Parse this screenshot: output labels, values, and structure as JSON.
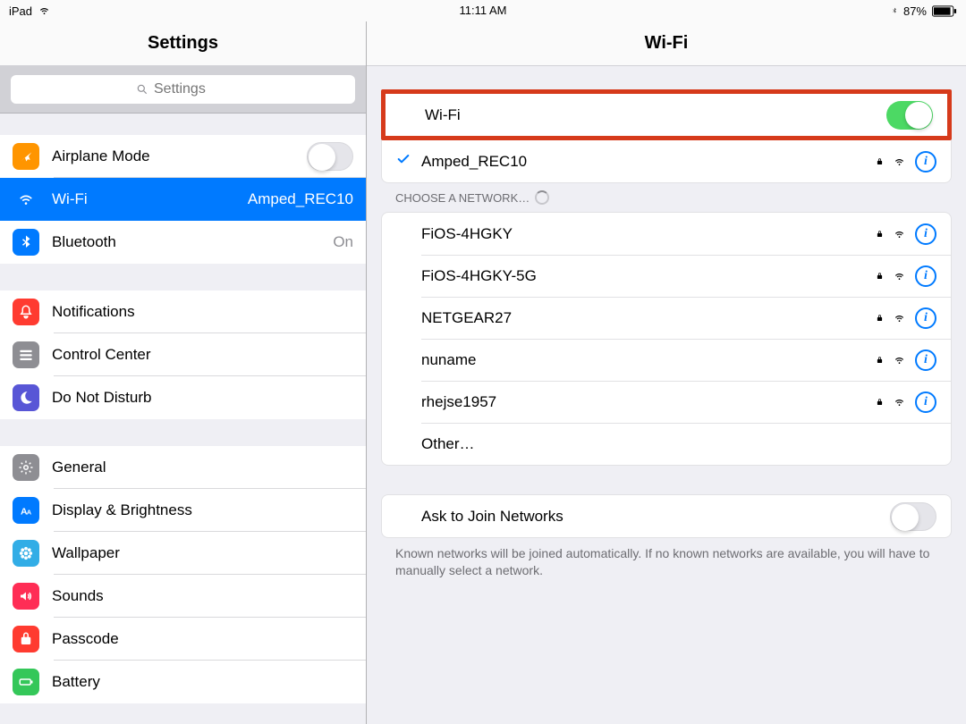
{
  "status": {
    "device": "iPad",
    "time": "11:11 AM",
    "battery_pct": "87%"
  },
  "sidebar": {
    "title": "Settings",
    "search_placeholder": "Settings",
    "groups": [
      {
        "items": [
          {
            "id": "airplane-mode",
            "label": "Airplane Mode",
            "icon": "airplane",
            "accessory": "switch-off"
          },
          {
            "id": "wifi",
            "label": "Wi-Fi",
            "icon": "wifi",
            "detail": "Amped_REC10",
            "selected": true
          },
          {
            "id": "bluetooth",
            "label": "Bluetooth",
            "icon": "bluetooth",
            "detail": "On"
          }
        ]
      },
      {
        "items": [
          {
            "id": "notifications",
            "label": "Notifications",
            "icon": "notifications"
          },
          {
            "id": "control-center",
            "label": "Control Center",
            "icon": "control-center"
          },
          {
            "id": "dnd",
            "label": "Do Not Disturb",
            "icon": "dnd"
          }
        ]
      },
      {
        "items": [
          {
            "id": "general",
            "label": "General",
            "icon": "general"
          },
          {
            "id": "display",
            "label": "Display & Brightness",
            "icon": "display"
          },
          {
            "id": "wallpaper",
            "label": "Wallpaper",
            "icon": "wallpaper"
          },
          {
            "id": "sounds",
            "label": "Sounds",
            "icon": "sounds"
          },
          {
            "id": "passcode",
            "label": "Passcode",
            "icon": "passcode"
          },
          {
            "id": "battery",
            "label": "Battery",
            "icon": "battery"
          }
        ]
      }
    ]
  },
  "detail": {
    "title": "Wi-Fi",
    "wifi_toggle_label": "Wi-Fi",
    "wifi_on": true,
    "connected_network": "Amped_REC10",
    "choose_header": "CHOOSE A NETWORK…",
    "networks": [
      {
        "name": "FiOS-4HGKY",
        "locked": true
      },
      {
        "name": "FiOS-4HGKY-5G",
        "locked": true
      },
      {
        "name": "NETGEAR27",
        "locked": true
      },
      {
        "name": "nuname",
        "locked": true
      },
      {
        "name": "rhejse1957",
        "locked": true
      }
    ],
    "other_label": "Other…",
    "ask_label": "Ask to Join Networks",
    "ask_on": false,
    "ask_footer": "Known networks will be joined automatically. If no known networks are available, you will have to manually select a network."
  }
}
